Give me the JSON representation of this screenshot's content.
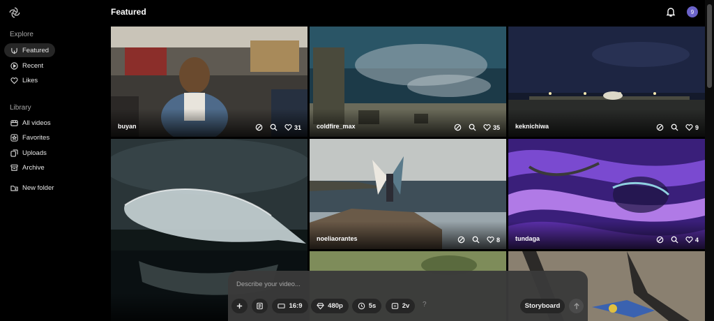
{
  "header": {
    "title": "Featured",
    "avatar_initial": "9"
  },
  "sidebar": {
    "explore_label": "Explore",
    "explore_items": [
      {
        "label": "Featured",
        "icon": "featured-icon",
        "active": true
      },
      {
        "label": "Recent",
        "icon": "recent-icon"
      },
      {
        "label": "Likes",
        "icon": "heart-icon"
      }
    ],
    "library_label": "Library",
    "library_items": [
      {
        "label": "All videos",
        "icon": "videos-icon"
      },
      {
        "label": "Favorites",
        "icon": "star-icon"
      },
      {
        "label": "Uploads",
        "icon": "uploads-icon"
      },
      {
        "label": "Archive",
        "icon": "archive-icon"
      },
      {
        "label": "New folder",
        "icon": "new-folder-icon"
      }
    ]
  },
  "videos": [
    {
      "user": "buyan",
      "likes": "31"
    },
    {
      "user": "coldfire_max",
      "likes": "35"
    },
    {
      "user": "keknichiwa",
      "likes": "9"
    },
    {
      "user": "",
      "likes": ""
    },
    {
      "user": "noeliaorantes",
      "likes": "8"
    },
    {
      "user": "tundaga",
      "likes": "4"
    }
  ],
  "prompt": {
    "placeholder": "Describe your video...",
    "aspect": "16:9",
    "resolution": "480p",
    "duration": "5s",
    "variations": "2v",
    "help": "?",
    "storyboard": "Storyboard"
  },
  "colors": {
    "background": "#000000",
    "accent": "#6b63c9",
    "panel": "#3a3a3a"
  }
}
